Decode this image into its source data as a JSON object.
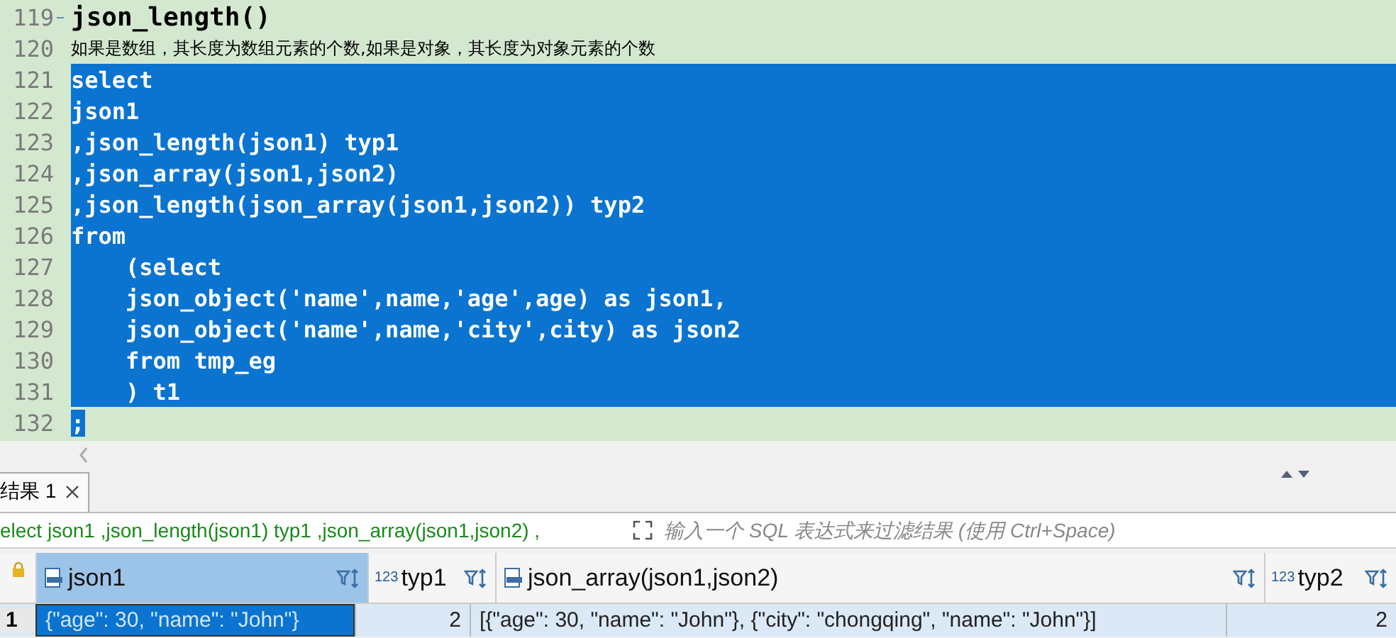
{
  "editor": {
    "lines": [
      {
        "number": "119",
        "text": "json_length()",
        "kind": "heading",
        "selected": false,
        "foldable": true
      },
      {
        "number": "120",
        "text": "如果是数组，其长度为数组元素的个数,如果是对象，其长度为对象元素的个数",
        "kind": "comment",
        "selected": false,
        "foldable": false
      },
      {
        "number": "121",
        "text": "select",
        "kind": "code",
        "selected": true,
        "foldable": false
      },
      {
        "number": "122",
        "text": "json1",
        "kind": "code",
        "selected": true,
        "foldable": false
      },
      {
        "number": "123",
        "text": ",json_length(json1) typ1",
        "kind": "code",
        "selected": true,
        "foldable": false
      },
      {
        "number": "124",
        "text": ",json_array(json1,json2)",
        "kind": "code",
        "selected": true,
        "foldable": false
      },
      {
        "number": "125",
        "text": ",json_length(json_array(json1,json2)) typ2",
        "kind": "code",
        "selected": true,
        "foldable": false
      },
      {
        "number": "126",
        "text": "from",
        "kind": "code",
        "selected": true,
        "foldable": false
      },
      {
        "number": "127",
        "text": "    (select",
        "kind": "code",
        "selected": true,
        "foldable": false
      },
      {
        "number": "128",
        "text": "    json_object('name',name,'age',age) as json1,",
        "kind": "code",
        "selected": true,
        "foldable": false
      },
      {
        "number": "129",
        "text": "    json_object('name',name,'city',city) as json2",
        "kind": "code",
        "selected": true,
        "foldable": false
      },
      {
        "number": "130",
        "text": "    from tmp_eg",
        "kind": "code",
        "selected": true,
        "foldable": false
      },
      {
        "number": "131",
        "text": "    ) t1",
        "kind": "code",
        "selected": true,
        "foldable": false
      },
      {
        "number": "132",
        "text": ";",
        "kind": "code",
        "selected": true,
        "foldable": false
      }
    ]
  },
  "results": {
    "tabs": [
      {
        "label": "结果 1",
        "selected": true
      }
    ],
    "filter": {
      "query": "elect json1 ,json_length(json1) typ1 ,json_array(json1,json2) ,",
      "placeholder": "输入一个 SQL 表达式来过滤结果 (使用 Ctrl+Space)"
    },
    "table": {
      "columns": [
        {
          "kind": "json",
          "label": "json1",
          "selected": true
        },
        {
          "kind": "number",
          "type_badge": "123",
          "label": "typ1",
          "selected": false
        },
        {
          "kind": "json",
          "label": "json_array(json1,json2)",
          "selected": false
        },
        {
          "kind": "number",
          "type_badge": "123",
          "label": "typ2",
          "selected": false
        }
      ],
      "rows": [
        {
          "number": "1",
          "cells": [
            "{\"age\": 30, \"name\": \"John\"}",
            "2",
            "[{\"age\": 30, \"name\": \"John\"}, {\"city\": \"chongqing\", \"name\": \"John\"}]",
            "2"
          ]
        }
      ]
    }
  }
}
